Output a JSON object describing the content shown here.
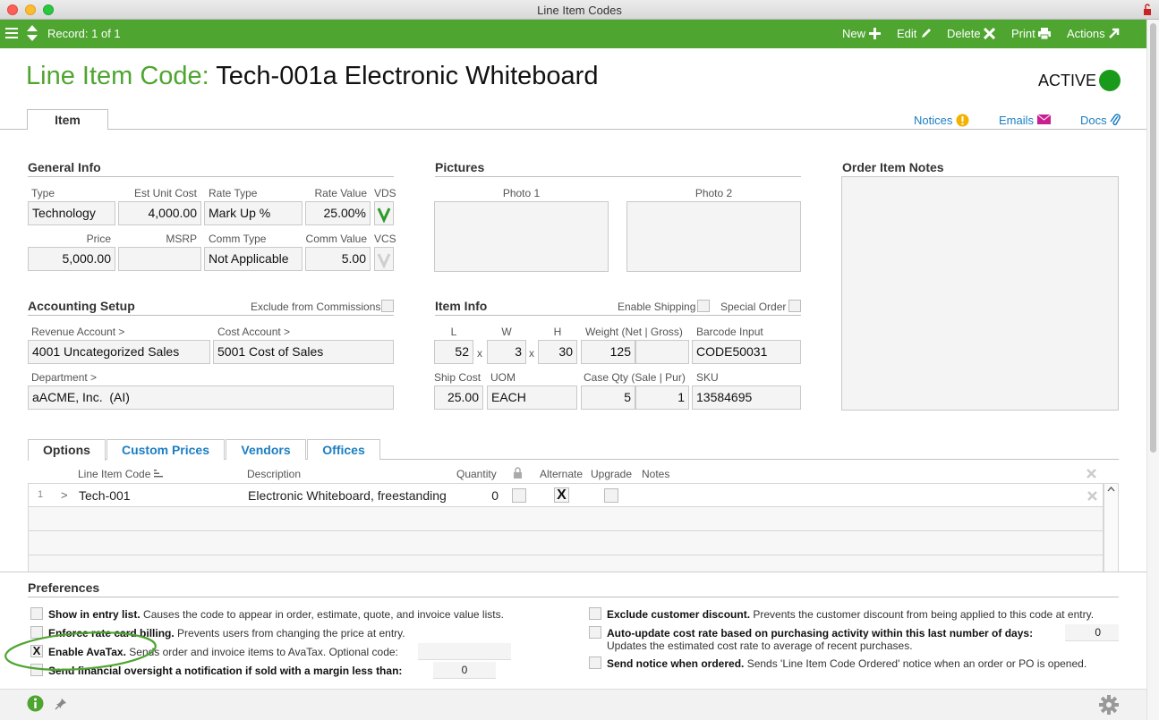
{
  "window": {
    "title": "Line Item Codes"
  },
  "toolbar": {
    "record": "Record: 1 of 1",
    "new": "New",
    "edit": "Edit",
    "delete": "Delete",
    "print": "Print",
    "actions": "Actions"
  },
  "header": {
    "label": "Line Item Code:",
    "name": "Tech-001a Electronic Whiteboard",
    "status": "ACTIVE",
    "status_color": "#1a9a1a"
  },
  "tabs": {
    "item": "Item"
  },
  "links": {
    "notices": "Notices",
    "emails": "Emails",
    "docs": "Docs"
  },
  "general": {
    "title": "General Info",
    "type_label": "Type",
    "type": "Technology",
    "est_unit_cost_label": "Est Unit Cost",
    "est_unit_cost": "4,000.00",
    "rate_type_label": "Rate Type",
    "rate_type": "Mark Up %",
    "rate_value_label": "Rate Value",
    "rate_value": "25.00%",
    "vds_label": "VDS",
    "price_label": "Price",
    "price": "5,000.00",
    "msrp_label": "MSRP",
    "msrp": "",
    "comm_type_label": "Comm Type",
    "comm_type": "Not Applicable",
    "comm_value_label": "Comm Value",
    "comm_value": "5.00",
    "vcs_label": "VCS"
  },
  "pictures": {
    "title": "Pictures",
    "photo1": "Photo 1",
    "photo2": "Photo 2"
  },
  "notes": {
    "title": "Order Item Notes"
  },
  "accounting": {
    "title": "Accounting Setup",
    "exclude_label": "Exclude from Commissions",
    "revenue_label": "Revenue Account >",
    "revenue": "4001 Uncategorized Sales",
    "cost_label": "Cost Account >",
    "cost": "5001 Cost of Sales",
    "department_label": "Department >",
    "department": "aACME, Inc.  (AI)"
  },
  "item_info": {
    "title": "Item Info",
    "enable_shipping_label": "Enable Shipping",
    "special_order_label": "Special Order",
    "l_label": "L",
    "l": "52",
    "w_label": "W",
    "w": "3",
    "h_label": "H",
    "h": "30",
    "x": "x",
    "weight_label": "Weight (Net | Gross)",
    "weight_net": "125",
    "weight_gross": "",
    "barcode_label": "Barcode Input",
    "barcode": "CODE50031",
    "ship_cost_label": "Ship Cost",
    "ship_cost": "25.00",
    "uom_label": "UOM",
    "uom": "EACH",
    "case_qty_label": "Case Qty (Sale | Pur)",
    "case_sale": "5",
    "case_pur": "1",
    "sku_label": "SKU",
    "sku": "13584695"
  },
  "subtabs": [
    "Options",
    "Custom Prices",
    "Vendors",
    "Offices"
  ],
  "options_table": {
    "headers": {
      "code": "Line Item Code",
      "description": "Description",
      "quantity": "Quantity",
      "alternate": "Alternate",
      "upgrade": "Upgrade",
      "notes": "Notes"
    },
    "rows": [
      {
        "num": "1",
        "arrow": ">",
        "code": "Tech-001",
        "description": "Electronic Whiteboard, freestanding",
        "quantity": "0",
        "alternate": "X"
      }
    ]
  },
  "preferences": {
    "title": "Preferences",
    "show_in_entry_bold": "Show in entry list.",
    "show_in_entry_text": " Causes the code to appear in order, estimate, quote, and invoice value lists.",
    "enforce_bold": "Enforce rate card billing.",
    "enforce_text": " Prevents users from changing the price at entry.",
    "avatax_bold": "Enable AvaTax.",
    "avatax_text": " Sends order and invoice items to AvaTax. Optional code:",
    "avatax_check": "X",
    "oversight_bold": "Send financial oversight a notification if sold with a margin less than:",
    "oversight_value": "0",
    "exclude_discount_bold": "Exclude customer discount.",
    "exclude_discount_text": " Prevents the customer discount from being applied to this code at entry.",
    "auto_update_bold": "Auto-update cost rate based on purchasing activity within this last number of days:",
    "auto_update_value": "0",
    "auto_update_text": "Updates the estimated cost rate to average of recent purchases.",
    "send_notice_bold": "Send notice when ordered.",
    "send_notice_text": " Sends 'Line Item Code Ordered' notice when an order or PO is opened."
  },
  "colors": {
    "brand_green": "#4ea530",
    "link_blue": "#1b7ec2"
  }
}
